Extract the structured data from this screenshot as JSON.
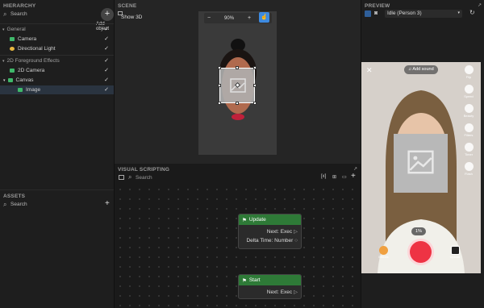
{
  "hierarchy": {
    "title": "HIERARCHY",
    "search_placeholder": "Search",
    "tooltip": "Add object",
    "groups": [
      {
        "label": "General",
        "items": [
          {
            "label": "Camera",
            "color": "#3fb86a"
          },
          {
            "label": "Directional Light",
            "color": "#e8b840"
          }
        ]
      },
      {
        "label": "2D Foreground Effects",
        "items": [
          {
            "label": "2D Camera",
            "color": "#3fb86a"
          },
          {
            "label": "Canvas",
            "color": "#3fb86a"
          },
          {
            "label": "Image",
            "color": "#3fb86a"
          }
        ]
      }
    ]
  },
  "assets": {
    "title": "ASSETS",
    "search_placeholder": "Search"
  },
  "scene": {
    "title": "SCENE",
    "show3d_label": "Show 3D",
    "zoom": "90%"
  },
  "visual_scripting": {
    "title": "VISUAL SCRIPTING",
    "search_placeholder": "Search",
    "nodes": [
      {
        "title": "Update",
        "pins": [
          "Next: Exec",
          "Delta Time: Number"
        ]
      },
      {
        "title": "Start",
        "pins": [
          "Next: Exec"
        ]
      }
    ]
  },
  "preview": {
    "title": "PREVIEW",
    "person": "Idle (Person 3)",
    "add_sound": "Add sound",
    "percent": "1%",
    "side_buttons": [
      "Flip",
      "Speed",
      "Beauty",
      "Filters",
      "Timer",
      "Flash"
    ],
    "bottom_left": "Effects",
    "bottom_right": "Upload"
  },
  "colors": {
    "accent": "#3d8ae0",
    "node_header": "#2e7a37",
    "record": "#ee3344"
  }
}
